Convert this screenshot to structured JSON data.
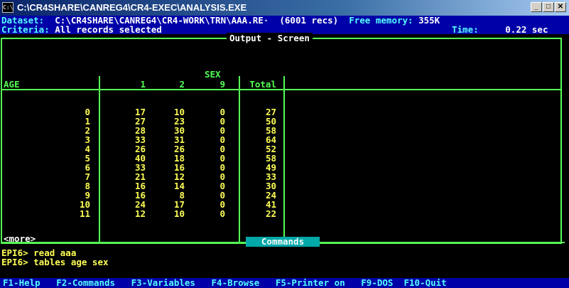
{
  "window": {
    "title": "C:\\CR4SHARE\\CANREG4\\CR4-EXEC\\ANALYSIS.EXE",
    "icon": "dos-prompt-icon",
    "controls": [
      "minimize-icon",
      "maximize-icon",
      "close-icon"
    ]
  },
  "header": {
    "dataset_label": "Dataset:",
    "dataset_value": "C:\\CR4SHARE\\CANREG4\\CR4-WORK\\TRN\\AAA.RE",
    "dataset_sep": "·",
    "records": "(6001 recs)",
    "memory_label": "Free memory:",
    "memory_value": "355K",
    "criteria_label": "Criteria:",
    "criteria_value": "All records selected",
    "time_label": "Time:",
    "time_value": "0.22 sec"
  },
  "output": {
    "title": "Output - Screen",
    "row_var": "AGE",
    "col_var": "SEX",
    "columns": [
      "1",
      "2",
      "9",
      "Total"
    ],
    "ages": [
      "0",
      "1",
      "2",
      "3",
      "4",
      "5",
      "6",
      "7",
      "8",
      "9",
      "10",
      "11"
    ],
    "col1": [
      "17",
      "27",
      "28",
      "33",
      "26",
      "40",
      "33",
      "21",
      "16",
      "16",
      "24",
      "12"
    ],
    "col2": [
      "10",
      "23",
      "30",
      "31",
      "26",
      "18",
      "16",
      "12",
      "14",
      "8",
      "17",
      "10"
    ],
    "col9": [
      "0",
      "0",
      "0",
      "0",
      "0",
      "0",
      "0",
      "0",
      "0",
      "0",
      "0",
      "0"
    ],
    "total": [
      "27",
      "50",
      "58",
      "64",
      "52",
      "58",
      "49",
      "33",
      "30",
      "24",
      "41",
      "22"
    ],
    "more": "<more>"
  },
  "commands": {
    "title": "Commands",
    "lines": [
      "EPI6> read aaa",
      "EPI6> tables age sex"
    ]
  },
  "fkeys": [
    "F1-Help",
    "F2-Commands",
    "F3-Variables",
    "F4-Browse",
    "F5-Printer on",
    "F9-DOS",
    "F10-Quit"
  ],
  "colors": {
    "background": "#000000",
    "frame": "#55ff55",
    "values": "#ffff55",
    "status_bar": "#0000a8",
    "status_text": "#55ffff"
  }
}
